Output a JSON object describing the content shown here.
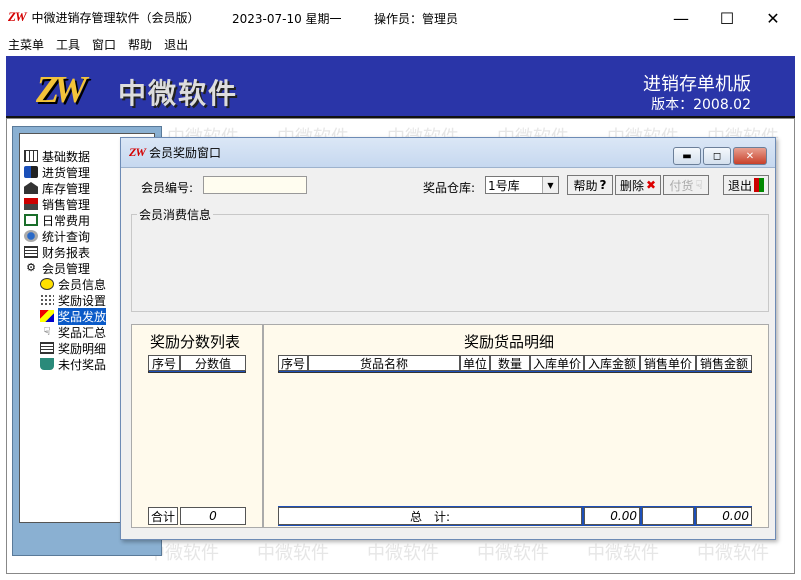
{
  "window": {
    "logo": "ZW",
    "title": "中微进销存管理软件（会员版）",
    "date": "2023-07-10 星期一",
    "operator": "操作员：管理员"
  },
  "menu": [
    "主菜单",
    "工具",
    "窗口",
    "帮助",
    "退出"
  ],
  "banner": {
    "logo": "ZW",
    "name": "中微软件",
    "edition": "进销存单机版",
    "version": "版本：2008.02"
  },
  "watermark": "中微软件",
  "tree": [
    {
      "label": "基础数据",
      "icon": "grid-icon",
      "level": 0
    },
    {
      "label": "进货管理",
      "icon": "import-icon",
      "level": 0
    },
    {
      "label": "库存管理",
      "icon": "warehouse-icon",
      "level": 0
    },
    {
      "label": "销售管理",
      "icon": "sales-icon",
      "level": 0
    },
    {
      "label": "日常费用",
      "icon": "expense-icon",
      "level": 0
    },
    {
      "label": "统计查询",
      "icon": "stats-icon",
      "level": 0
    },
    {
      "label": "财务报表",
      "icon": "report-icon",
      "level": 0
    },
    {
      "label": "会员管理",
      "icon": "member-icon",
      "level": 0
    },
    {
      "label": "会员信息",
      "icon": "smiley-icon",
      "level": 1
    },
    {
      "label": "奖励设置",
      "icon": "dots-icon",
      "level": 1
    },
    {
      "label": "奖品发放",
      "icon": "shapes-icon",
      "level": 1,
      "selected": true
    },
    {
      "label": "奖品汇总",
      "icon": "hand-icon",
      "level": 1
    },
    {
      "label": "奖励明细",
      "icon": "list-icon",
      "level": 1
    },
    {
      "label": "未付奖品",
      "icon": "cup-icon",
      "level": 1
    }
  ],
  "dialog": {
    "logo": "ZW",
    "title": "会员奖励窗口",
    "member_no_label": "会员编号:",
    "member_no_value": "",
    "warehouse_label": "奖品仓库:",
    "warehouse_value": "1号库",
    "help_label": "帮助",
    "delete_label": "删除",
    "pay_label": "付货",
    "exit_label": "退出",
    "consume_group_label": "会员消费信息",
    "score_panel_title": "奖励分数列表",
    "score_columns": [
      "序号",
      "分数值"
    ],
    "score_total_label": "合计",
    "score_total_value": "0",
    "goods_panel_title": "奖励货品明细",
    "goods_columns": [
      "序号",
      "货品名称",
      "单位",
      "数量",
      "入库单价",
      "入库金额",
      "销售单价",
      "销售金额"
    ],
    "goods_total_label": "总　计:",
    "goods_total_in_amount": "0.00",
    "goods_total_sale_amount": "0.00"
  },
  "colors": {
    "banner": "#2a35a8",
    "selection": "#0a5ac8",
    "header_bar": "#1d4fb8",
    "panel_bg": "#fffaec"
  }
}
